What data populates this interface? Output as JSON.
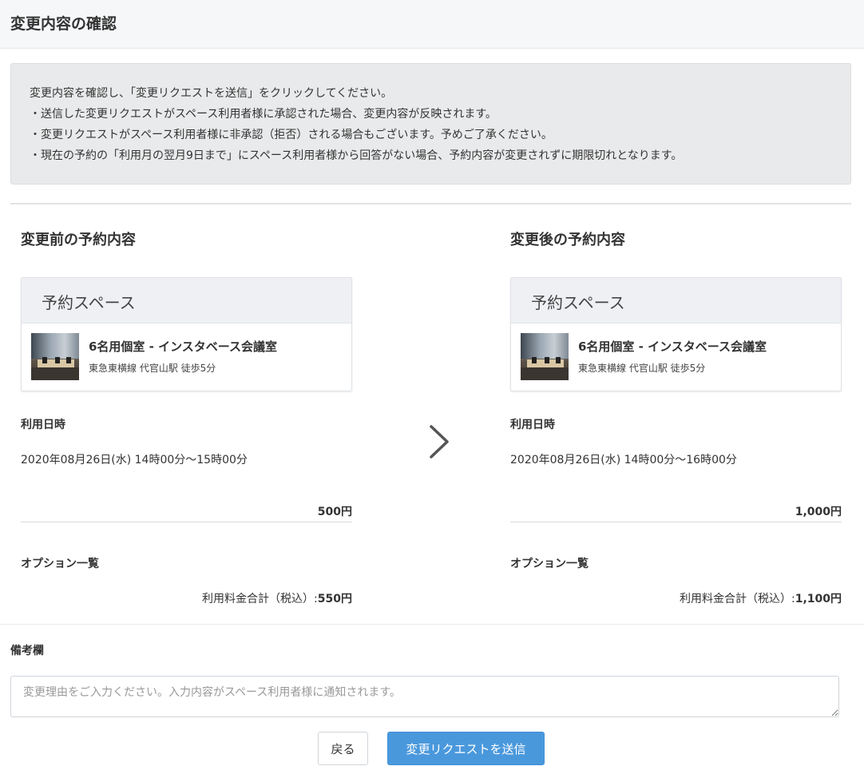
{
  "header": {
    "title": "変更内容の確認"
  },
  "notice": {
    "lines": [
      "変更内容を確認し、「変更リクエストを送信」をクリックしてください。",
      "・送信した変更リクエストがスペース利用者様に承認された場合、変更内容が反映されます。",
      "・変更リクエストがスペース利用者様に非承認（拒否）される場合もございます。予めご了承ください。",
      "・現在の予約の「利用月の翌月9日まで」にスペース利用者様から回答がない場合、予約内容が変更されずに期限切れとなります。"
    ]
  },
  "before": {
    "title": "変更前の予約内容",
    "space_heading": "予約スペース",
    "space_name": "6名用個室 - インスタベース会議室",
    "space_access": "東急東横線 代官山駅 徒歩5分",
    "datetime_label": "利用日時",
    "datetime_value": "2020年08月26日(水) 14時00分〜15時00分",
    "price": "500円",
    "options_label": "オプション一覧",
    "total_label": "利用料金合計（税込）:",
    "total_value": "550円"
  },
  "after": {
    "title": "変更後の予約内容",
    "space_heading": "予約スペース",
    "space_name": "6名用個室 - インスタベース会議室",
    "space_access": "東急東横線 代官山駅 徒歩5分",
    "datetime_label": "利用日時",
    "datetime_value": "2020年08月26日(水) 14時00分〜16時00分",
    "price": "1,000円",
    "options_label": "オプション一覧",
    "total_label": "利用料金合計（税込）:",
    "total_value": "1,100円"
  },
  "remarks": {
    "label": "備考欄",
    "placeholder": "変更理由をご入力ください。入力内容がスペース利用者様に通知されます。"
  },
  "actions": {
    "back_label": "戻る",
    "submit_label": "変更リクエストを送信"
  },
  "colors": {
    "primary": "#4a98dc",
    "header_bg": "#f5f7f9",
    "notice_bg": "#e9eaeb"
  }
}
